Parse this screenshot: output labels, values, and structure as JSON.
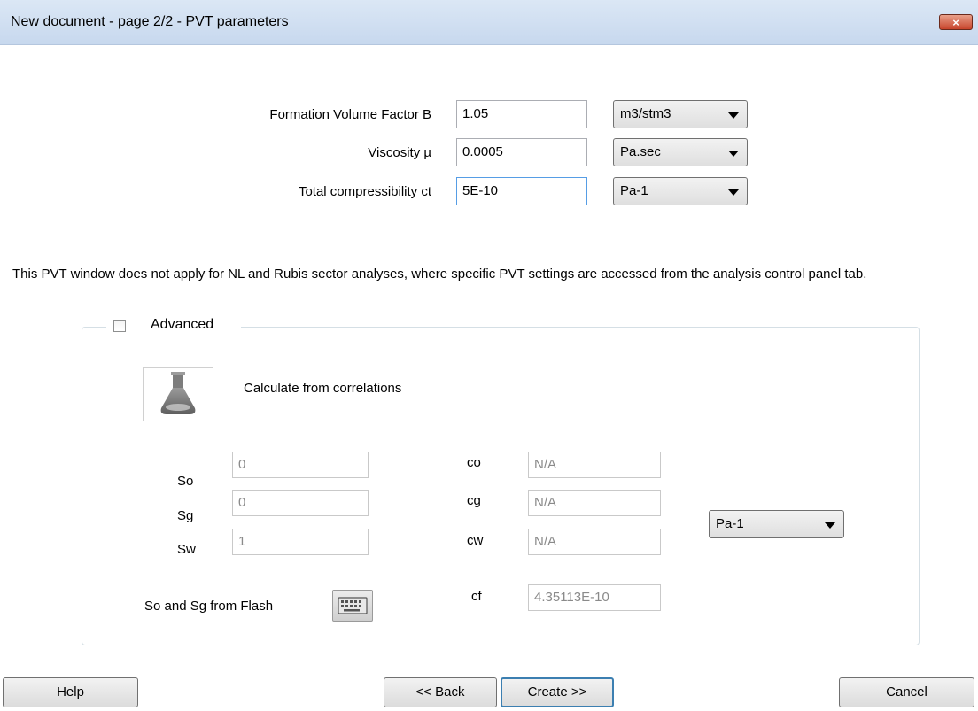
{
  "window": {
    "title": "New document - page 2/2 - PVT parameters",
    "close_glyph": "×"
  },
  "pvt": {
    "fvf": {
      "label": "Formation Volume Factor B",
      "value": "1.05",
      "unit": "m3/stm3"
    },
    "viscosity": {
      "label": "Viscosity µ",
      "value": "0.0005",
      "unit": "Pa.sec"
    },
    "compressibility": {
      "label": "Total compressibility ct",
      "value": "5E-10",
      "unit": "Pa-1"
    }
  },
  "description": "This PVT window does not apply for NL and Rubis sector analyses, where specific PVT settings are accessed from the analysis control panel tab.",
  "advanced": {
    "label": "Advanced",
    "checked": false,
    "correlations_label": "Calculate from correlations",
    "So": {
      "label": "So",
      "value": "0"
    },
    "Sg": {
      "label": "Sg",
      "value": "0"
    },
    "Sw": {
      "label": "Sw",
      "value": "1"
    },
    "co": {
      "label": "co",
      "value": "N/A"
    },
    "cg": {
      "label": "cg",
      "value": "N/A"
    },
    "cw": {
      "label": "cw",
      "value": "N/A"
    },
    "cf": {
      "label": "cf",
      "value": "4.35113E-10"
    },
    "flash_label": "So and Sg from Flash",
    "unit": "Pa-1"
  },
  "buttons": {
    "help": "Help",
    "back": "<< Back",
    "create": "Create >>",
    "cancel": "Cancel"
  },
  "icons": {
    "correlations": "flask-icon",
    "flash": "keyboard-icon",
    "close": "close-icon"
  }
}
